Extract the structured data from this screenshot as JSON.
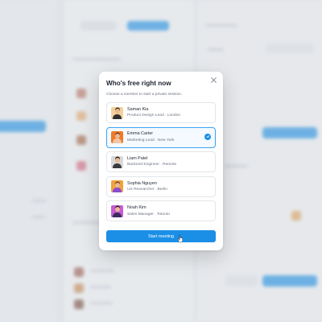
{
  "modal": {
    "title": "Who's free right now",
    "subtitle": "Choose a member to start a private session.",
    "close_icon": "close-icon",
    "start_label": "Start meeting"
  },
  "members": [
    {
      "name": "Saman Kia",
      "role": "Product Design Lead . London",
      "selected": false,
      "avatar_bg": "#f3d19c",
      "hair": "#3b2a1e",
      "shirt": "#2e2e2e"
    },
    {
      "name": "Emma Carter",
      "role": "Marketing Lead . New York",
      "selected": true,
      "avatar_bg": "#f07a2a",
      "hair": "#6b3a1f",
      "shirt": "#f2c7a5"
    },
    {
      "name": "Liam Patel",
      "role": "Backend Engineer . Remote",
      "selected": false,
      "avatar_bg": "#d9d9d9",
      "hair": "#1a1a1a",
      "shirt": "#3a3a3a"
    },
    {
      "name": "Sophia Nguyen",
      "role": "UX Researcher . Berlin",
      "selected": false,
      "avatar_bg": "#f0a23b",
      "hair": "#6e3b1b",
      "shirt": "#8a4bd6"
    },
    {
      "name": "Noah Kim",
      "role": "Sales Manager . Totonto",
      "selected": false,
      "avatar_bg": "#c85bd6",
      "hair": "#1e1e1e",
      "shirt": "#3b2b5c"
    }
  ],
  "colors": {
    "accent": "#1b8fe6",
    "selected_border": "#3aa3f0"
  }
}
